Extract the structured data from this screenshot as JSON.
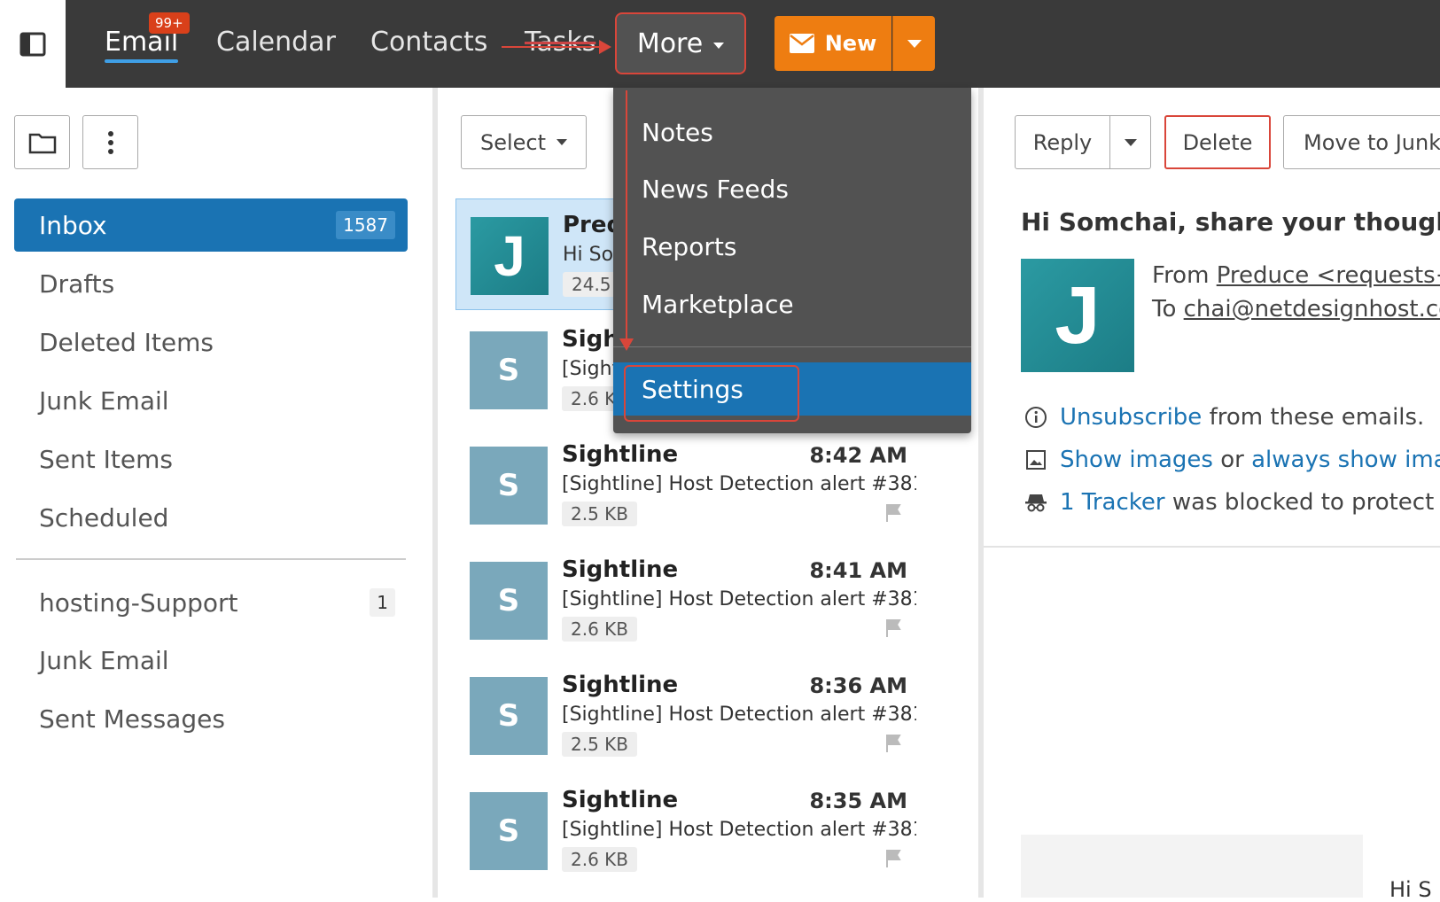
{
  "nav": {
    "email": "Email",
    "email_badge": "99+",
    "calendar": "Calendar",
    "contacts": "Contacts",
    "tasks": "Tasks",
    "more": "More",
    "new": "New"
  },
  "folders": {
    "inbox": {
      "label": "Inbox",
      "count": "1587"
    },
    "drafts": "Drafts",
    "deleted": "Deleted Items",
    "junk": "Junk Email",
    "sent": "Sent Items",
    "scheduled": "Scheduled",
    "support": {
      "label": "hosting-Support",
      "count": "1"
    },
    "junk2": "Junk Email",
    "sent_messages": "Sent Messages"
  },
  "list": {
    "select": "Select",
    "messages": [
      {
        "avatar": "J",
        "sender": "Pred",
        "subject": "Hi So",
        "size": "24.5"
      },
      {
        "avatar": "S",
        "sender": "Sigh",
        "subject": "[Sight",
        "size": "2.6 K"
      },
      {
        "avatar": "S",
        "sender": "Sightline",
        "time": "8:42 AM",
        "subject": "[Sightline] Host Detection alert #381...",
        "size": "2.5 KB"
      },
      {
        "avatar": "S",
        "sender": "Sightline",
        "time": "8:41 AM",
        "subject": "[Sightline] Host Detection alert #381...",
        "size": "2.6 KB"
      },
      {
        "avatar": "S",
        "sender": "Sightline",
        "time": "8:36 AM",
        "subject": "[Sightline] Host Detection alert #381...",
        "size": "2.5 KB"
      },
      {
        "avatar": "S",
        "sender": "Sightline",
        "time": "8:35 AM",
        "subject": "[Sightline] Host Detection alert #381...",
        "size": "2.6 KB"
      }
    ]
  },
  "menu": {
    "notes": "Notes",
    "news_feeds": "News Feeds",
    "reports": "Reports",
    "marketplace": "Marketplace",
    "settings": "Settings"
  },
  "reading": {
    "reply": "Reply",
    "delete": "Delete",
    "junk": "Move to Junk",
    "title": "Hi Somchai, share your thought",
    "avatar": "J",
    "from_label": "From",
    "from_addr": "Preduce <requests+",
    "to_label": "To",
    "to_addr": "chai@netdesignhost.co",
    "unsubscribe_link": "Unsubscribe",
    "unsubscribe_rest": "from these emails.",
    "show_images_link": "Show images",
    "or_text": "or",
    "always_show_link": "always show imag",
    "tracker_link": "1 Tracker",
    "tracker_rest": "was blocked to protect y",
    "preview_hi": "Hi S"
  },
  "colors": {
    "topbar": "#3a3a3a",
    "accent_blue": "#1a73b3",
    "new_button": "#ee7d11",
    "annotation_red": "#d9463a"
  }
}
